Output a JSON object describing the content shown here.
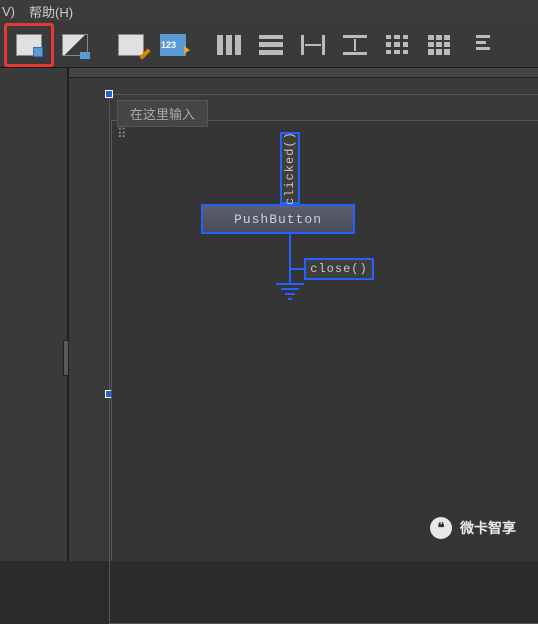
{
  "menu": {
    "view_suffix": "V)",
    "help": "帮助(H)"
  },
  "toolbar": {
    "icons": {
      "edit_widgets": "edit-widgets-icon",
      "edit_signals": "edit-signals-icon",
      "edit_buddies": "edit-buddies-icon",
      "edit_taborder": "edit-taborder-icon",
      "layout_h": "layout-horizontal-icon",
      "layout_v": "layout-vertical-icon",
      "layout_hsplit": "layout-horizontal-splitter-icon",
      "layout_vsplit": "layout-vertical-splitter-icon",
      "layout_grid_s": "layout-grid-sparse-icon",
      "layout_grid": "layout-grid-icon",
      "layout_form": "layout-form-icon"
    },
    "label_123": "123"
  },
  "canvas": {
    "type_here": "在这里输入",
    "pushbutton_label": "PushButton",
    "signal_clicked": "clicked()",
    "slot_close": "close()"
  },
  "watermark": {
    "icon_glyph": "❝",
    "text": "微卡智享"
  },
  "colors": {
    "highlight": "#e53935",
    "selection": "#2462ff"
  }
}
